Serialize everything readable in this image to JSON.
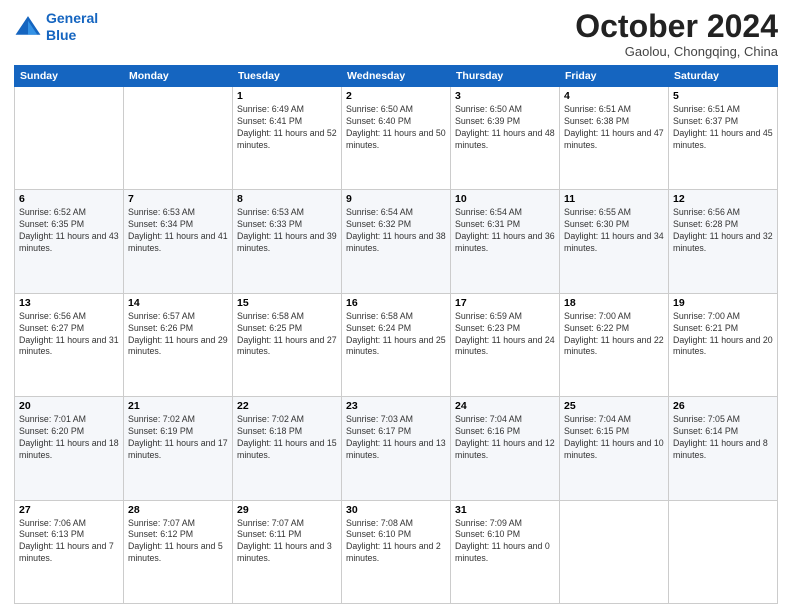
{
  "logo": {
    "line1": "General",
    "line2": "Blue"
  },
  "title": "October 2024",
  "location": "Gaolou, Chongqing, China",
  "days_header": [
    "Sunday",
    "Monday",
    "Tuesday",
    "Wednesday",
    "Thursday",
    "Friday",
    "Saturday"
  ],
  "weeks": [
    [
      {
        "day": "",
        "info": ""
      },
      {
        "day": "",
        "info": ""
      },
      {
        "day": "1",
        "info": "Sunrise: 6:49 AM\nSunset: 6:41 PM\nDaylight: 11 hours and 52 minutes."
      },
      {
        "day": "2",
        "info": "Sunrise: 6:50 AM\nSunset: 6:40 PM\nDaylight: 11 hours and 50 minutes."
      },
      {
        "day": "3",
        "info": "Sunrise: 6:50 AM\nSunset: 6:39 PM\nDaylight: 11 hours and 48 minutes."
      },
      {
        "day": "4",
        "info": "Sunrise: 6:51 AM\nSunset: 6:38 PM\nDaylight: 11 hours and 47 minutes."
      },
      {
        "day": "5",
        "info": "Sunrise: 6:51 AM\nSunset: 6:37 PM\nDaylight: 11 hours and 45 minutes."
      }
    ],
    [
      {
        "day": "6",
        "info": "Sunrise: 6:52 AM\nSunset: 6:35 PM\nDaylight: 11 hours and 43 minutes."
      },
      {
        "day": "7",
        "info": "Sunrise: 6:53 AM\nSunset: 6:34 PM\nDaylight: 11 hours and 41 minutes."
      },
      {
        "day": "8",
        "info": "Sunrise: 6:53 AM\nSunset: 6:33 PM\nDaylight: 11 hours and 39 minutes."
      },
      {
        "day": "9",
        "info": "Sunrise: 6:54 AM\nSunset: 6:32 PM\nDaylight: 11 hours and 38 minutes."
      },
      {
        "day": "10",
        "info": "Sunrise: 6:54 AM\nSunset: 6:31 PM\nDaylight: 11 hours and 36 minutes."
      },
      {
        "day": "11",
        "info": "Sunrise: 6:55 AM\nSunset: 6:30 PM\nDaylight: 11 hours and 34 minutes."
      },
      {
        "day": "12",
        "info": "Sunrise: 6:56 AM\nSunset: 6:28 PM\nDaylight: 11 hours and 32 minutes."
      }
    ],
    [
      {
        "day": "13",
        "info": "Sunrise: 6:56 AM\nSunset: 6:27 PM\nDaylight: 11 hours and 31 minutes."
      },
      {
        "day": "14",
        "info": "Sunrise: 6:57 AM\nSunset: 6:26 PM\nDaylight: 11 hours and 29 minutes."
      },
      {
        "day": "15",
        "info": "Sunrise: 6:58 AM\nSunset: 6:25 PM\nDaylight: 11 hours and 27 minutes."
      },
      {
        "day": "16",
        "info": "Sunrise: 6:58 AM\nSunset: 6:24 PM\nDaylight: 11 hours and 25 minutes."
      },
      {
        "day": "17",
        "info": "Sunrise: 6:59 AM\nSunset: 6:23 PM\nDaylight: 11 hours and 24 minutes."
      },
      {
        "day": "18",
        "info": "Sunrise: 7:00 AM\nSunset: 6:22 PM\nDaylight: 11 hours and 22 minutes."
      },
      {
        "day": "19",
        "info": "Sunrise: 7:00 AM\nSunset: 6:21 PM\nDaylight: 11 hours and 20 minutes."
      }
    ],
    [
      {
        "day": "20",
        "info": "Sunrise: 7:01 AM\nSunset: 6:20 PM\nDaylight: 11 hours and 18 minutes."
      },
      {
        "day": "21",
        "info": "Sunrise: 7:02 AM\nSunset: 6:19 PM\nDaylight: 11 hours and 17 minutes."
      },
      {
        "day": "22",
        "info": "Sunrise: 7:02 AM\nSunset: 6:18 PM\nDaylight: 11 hours and 15 minutes."
      },
      {
        "day": "23",
        "info": "Sunrise: 7:03 AM\nSunset: 6:17 PM\nDaylight: 11 hours and 13 minutes."
      },
      {
        "day": "24",
        "info": "Sunrise: 7:04 AM\nSunset: 6:16 PM\nDaylight: 11 hours and 12 minutes."
      },
      {
        "day": "25",
        "info": "Sunrise: 7:04 AM\nSunset: 6:15 PM\nDaylight: 11 hours and 10 minutes."
      },
      {
        "day": "26",
        "info": "Sunrise: 7:05 AM\nSunset: 6:14 PM\nDaylight: 11 hours and 8 minutes."
      }
    ],
    [
      {
        "day": "27",
        "info": "Sunrise: 7:06 AM\nSunset: 6:13 PM\nDaylight: 11 hours and 7 minutes."
      },
      {
        "day": "28",
        "info": "Sunrise: 7:07 AM\nSunset: 6:12 PM\nDaylight: 11 hours and 5 minutes."
      },
      {
        "day": "29",
        "info": "Sunrise: 7:07 AM\nSunset: 6:11 PM\nDaylight: 11 hours and 3 minutes."
      },
      {
        "day": "30",
        "info": "Sunrise: 7:08 AM\nSunset: 6:10 PM\nDaylight: 11 hours and 2 minutes."
      },
      {
        "day": "31",
        "info": "Sunrise: 7:09 AM\nSunset: 6:10 PM\nDaylight: 11 hours and 0 minutes."
      },
      {
        "day": "",
        "info": ""
      },
      {
        "day": "",
        "info": ""
      }
    ]
  ]
}
